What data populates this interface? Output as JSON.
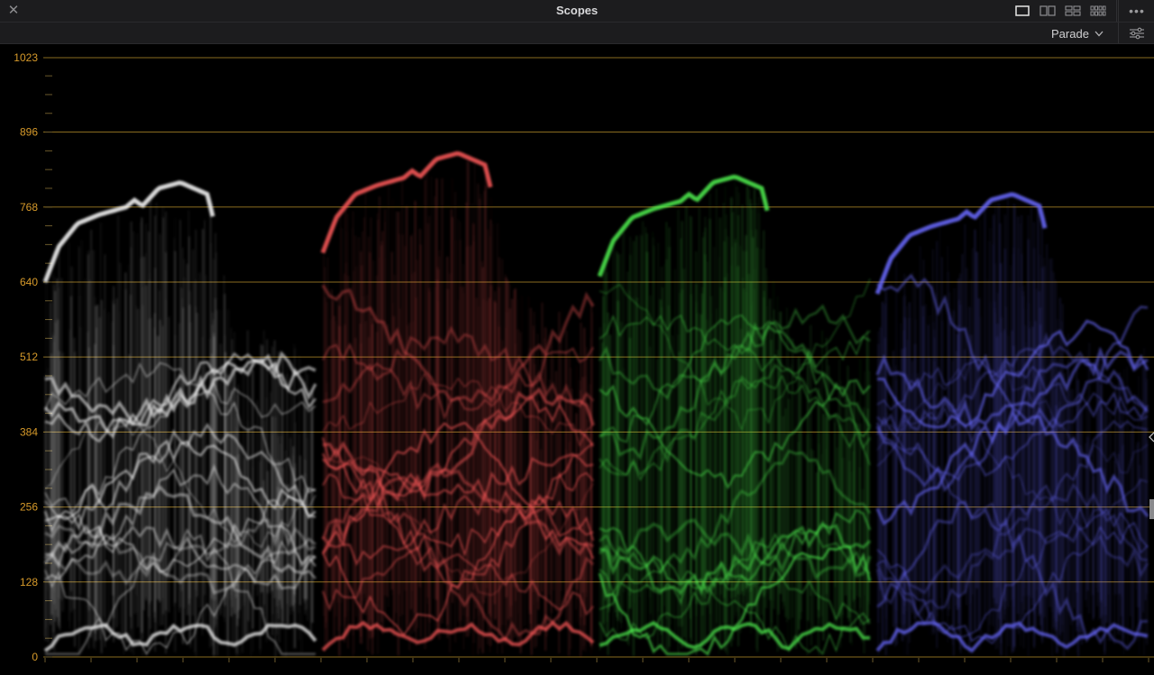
{
  "window": {
    "title": "Scopes",
    "close_icon": "close-icon",
    "layout_icons": [
      "single-view-icon",
      "dual-view-icon",
      "quad-view-icon",
      "grid-view-icon"
    ],
    "more_icon": "more-options-icon"
  },
  "toolbar": {
    "scope_mode": "Parade",
    "dropdown_icon": "chevron-down-icon",
    "settings_icon": "sliders-settings-icon"
  },
  "scope": {
    "y_axis_ticks": [
      "1023",
      "896",
      "768",
      "640",
      "512",
      "384",
      "256",
      "128",
      "0"
    ],
    "channels": [
      {
        "name": "luma/white",
        "color": "#ffffff"
      },
      {
        "name": "red",
        "color": "#ff5a5a"
      },
      {
        "name": "green",
        "color": "#50f050"
      },
      {
        "name": "blue",
        "color": "#6a6aff"
      }
    ],
    "gridline_color": "#b8902a",
    "label_color": "#d79a2a"
  }
}
